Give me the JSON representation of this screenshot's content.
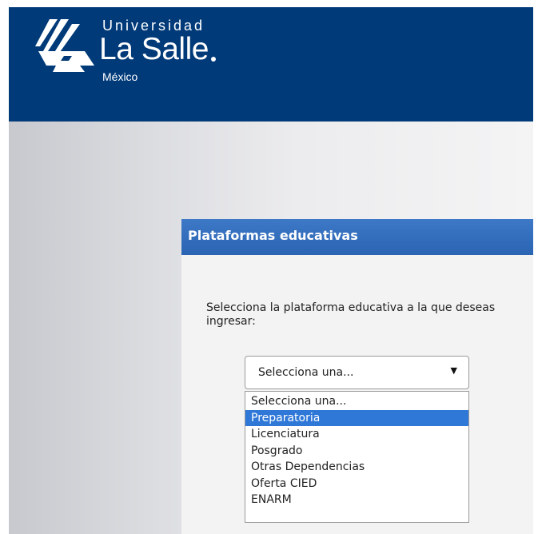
{
  "header": {
    "logo_university": "Universidad",
    "logo_name": "La Salle",
    "logo_country": "México"
  },
  "panel": {
    "title": "Plataformas educativas",
    "prompt": "Selecciona la plataforma educativa a la que deseas ingresar:"
  },
  "select": {
    "value": "Selecciona una...",
    "arrow_icon": "triangle-down",
    "options": [
      {
        "label": "Selecciona una...",
        "highlighted": false
      },
      {
        "label": "Preparatoria",
        "highlighted": true
      },
      {
        "label": "Licenciatura",
        "highlighted": false
      },
      {
        "label": "Posgrado",
        "highlighted": false
      },
      {
        "label": "Otras Dependencias",
        "highlighted": false
      },
      {
        "label": "Oferta CIED",
        "highlighted": false
      },
      {
        "label": "ENARM",
        "highlighted": false
      }
    ]
  },
  "colors": {
    "header_bg": "#003a79",
    "panel_header": "#2f6cbd",
    "highlight": "#2f78d8"
  }
}
